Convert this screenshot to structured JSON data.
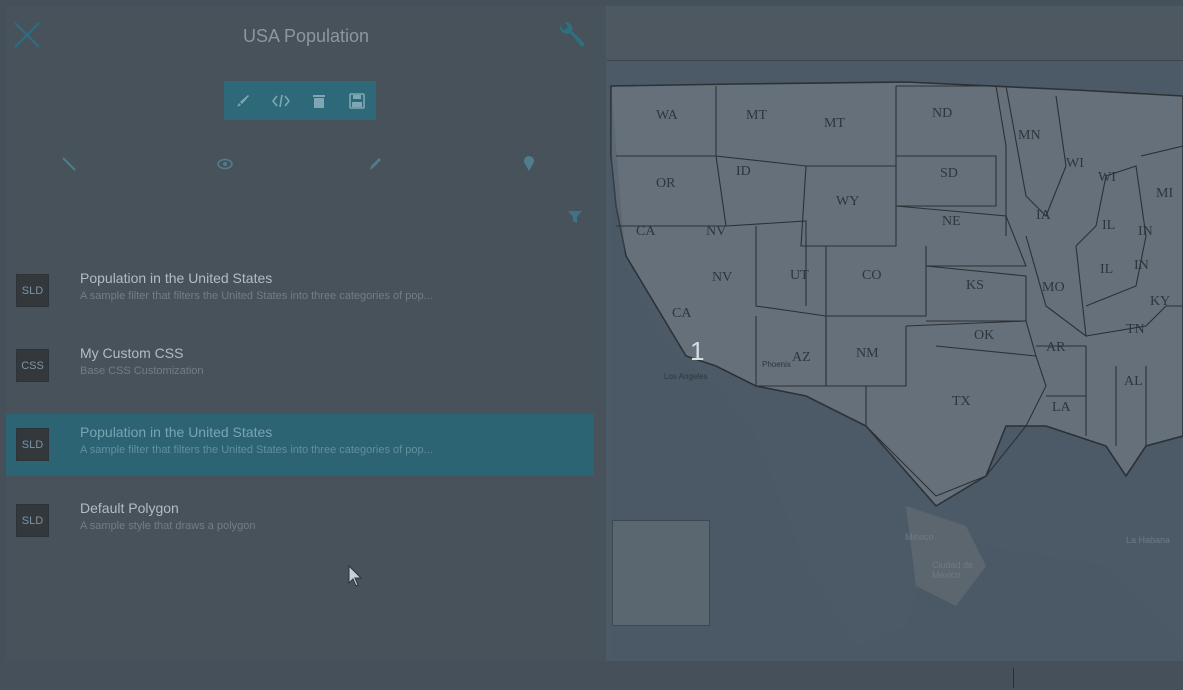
{
  "header": {
    "title": "USA Population"
  },
  "toolbar": {
    "buttons": [
      "paint-brush-icon",
      "code-icon",
      "trash-icon",
      "save-icon"
    ]
  },
  "tabs": [
    "wrench-icon",
    "eye-icon",
    "pencil-icon",
    "map-marker-icon"
  ],
  "style_list": [
    {
      "badge": "SLD",
      "title": "Population in the United States",
      "desc": "A sample filter that filters the United States into three categories of pop..."
    },
    {
      "badge": "CSS",
      "title": "My Custom CSS",
      "desc": "Base CSS Customization"
    },
    {
      "badge": "SLD",
      "title": "Population in the United States",
      "desc": "A sample filter that filters the United States into three categories of pop..."
    },
    {
      "badge": "SLD",
      "title": "Default Polygon",
      "desc": "A sample style that draws a polygon"
    }
  ],
  "map": {
    "cluster_count": "1",
    "state_labels": [
      "WA",
      "MT",
      "MT",
      "ND",
      "MN",
      "OR",
      "ID",
      "SD",
      "WI",
      "WI",
      "MI",
      "WY",
      "CA",
      "NV",
      "NE",
      "IA",
      "IL",
      "IN",
      "NV",
      "UT",
      "CO",
      "KS",
      "MO",
      "IL",
      "IN",
      "KY",
      "CA",
      "OK",
      "TN",
      "AR",
      "AZ",
      "NM",
      "AL",
      "TX",
      "LA"
    ],
    "city_labels": [
      "Los Angeles",
      "Phoenix",
      "Mexico",
      "Ciudad de México",
      "La Habana"
    ]
  },
  "colors": {
    "accent": "#2d6978",
    "panel": "#47525b",
    "map": "#4a5866"
  }
}
